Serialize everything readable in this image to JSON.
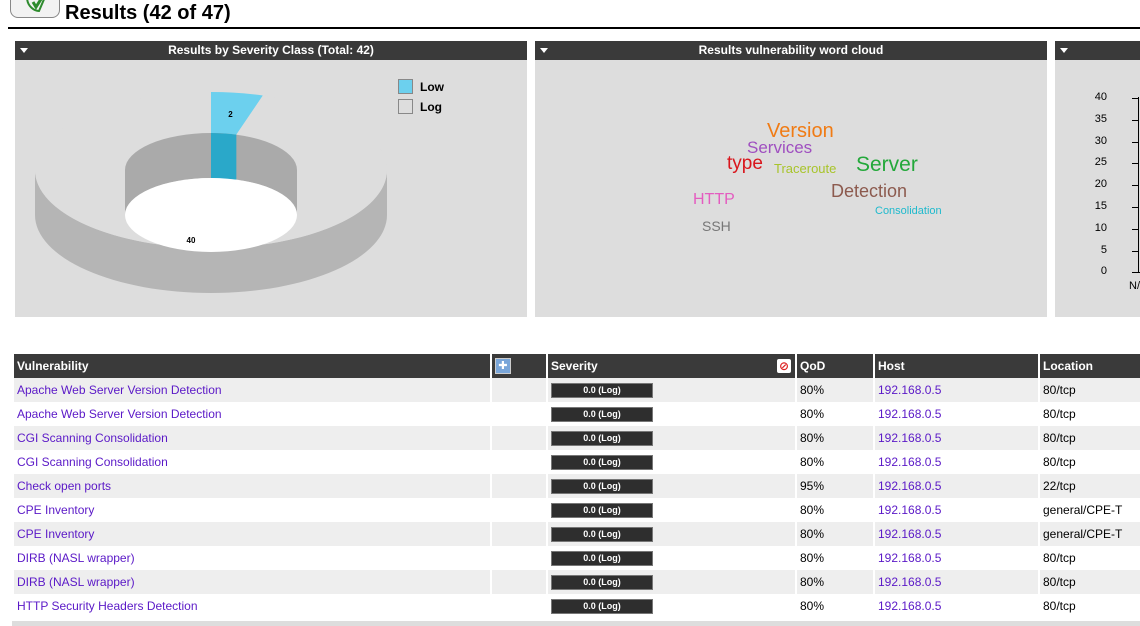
{
  "header": {
    "title": "Results (42 of 47)"
  },
  "severity_panel": {
    "title": "Results by Severity Class (Total: 42)",
    "legend": [
      {
        "label": "Low",
        "color": "#6cd0ee"
      },
      {
        "label": "Log",
        "color": "#dddddd"
      }
    ],
    "slices": [
      {
        "label": "Low",
        "value": 2
      },
      {
        "label": "Log",
        "value": 40
      }
    ]
  },
  "cloud_panel": {
    "title": "Results vulnerability word cloud",
    "words": [
      {
        "text": "Version",
        "color": "#f07b14"
      },
      {
        "text": "Services",
        "color": "#9f4fc0"
      },
      {
        "text": "type",
        "color": "#d9161d"
      },
      {
        "text": "Traceroute",
        "color": "#a8c42a"
      },
      {
        "text": "Server",
        "color": "#23a83a"
      },
      {
        "text": "Detection",
        "color": "#8c5a4e"
      },
      {
        "text": "HTTP",
        "color": "#e45cc0"
      },
      {
        "text": "Consolidation",
        "color": "#1fbacd"
      },
      {
        "text": "SSH",
        "color": "#777777"
      }
    ]
  },
  "chart_panel": {
    "y_ticks": [
      "40",
      "35",
      "30",
      "25",
      "20",
      "15",
      "10",
      "5",
      "0"
    ],
    "x_label": "N/"
  },
  "table": {
    "headers": {
      "vulnerability": "Vulnerability",
      "severity": "Severity",
      "qod": "QoD",
      "host": "Host",
      "location": "Location"
    },
    "rows": [
      {
        "name": "Apache Web Server Version Detection",
        "severity": "0.0 (Log)",
        "qod": "80%",
        "host": "192.168.0.5",
        "location": "80/tcp"
      },
      {
        "name": "Apache Web Server Version Detection",
        "severity": "0.0 (Log)",
        "qod": "80%",
        "host": "192.168.0.5",
        "location": "80/tcp"
      },
      {
        "name": "CGI Scanning Consolidation",
        "severity": "0.0 (Log)",
        "qod": "80%",
        "host": "192.168.0.5",
        "location": "80/tcp"
      },
      {
        "name": "CGI Scanning Consolidation",
        "severity": "0.0 (Log)",
        "qod": "80%",
        "host": "192.168.0.5",
        "location": "80/tcp"
      },
      {
        "name": "Check open ports",
        "severity": "0.0 (Log)",
        "qod": "95%",
        "host": "192.168.0.5",
        "location": "22/tcp"
      },
      {
        "name": "CPE Inventory",
        "severity": "0.0 (Log)",
        "qod": "80%",
        "host": "192.168.0.5",
        "location": "general/CPE-T"
      },
      {
        "name": "CPE Inventory",
        "severity": "0.0 (Log)",
        "qod": "80%",
        "host": "192.168.0.5",
        "location": "general/CPE-T"
      },
      {
        "name": "DIRB (NASL wrapper)",
        "severity": "0.0 (Log)",
        "qod": "80%",
        "host": "192.168.0.5",
        "location": "80/tcp"
      },
      {
        "name": "DIRB (NASL wrapper)",
        "severity": "0.0 (Log)",
        "qod": "80%",
        "host": "192.168.0.5",
        "location": "80/tcp"
      },
      {
        "name": "HTTP Security Headers Detection",
        "severity": "0.0 (Log)",
        "qod": "80%",
        "host": "192.168.0.5",
        "location": "80/tcp"
      }
    ]
  }
}
